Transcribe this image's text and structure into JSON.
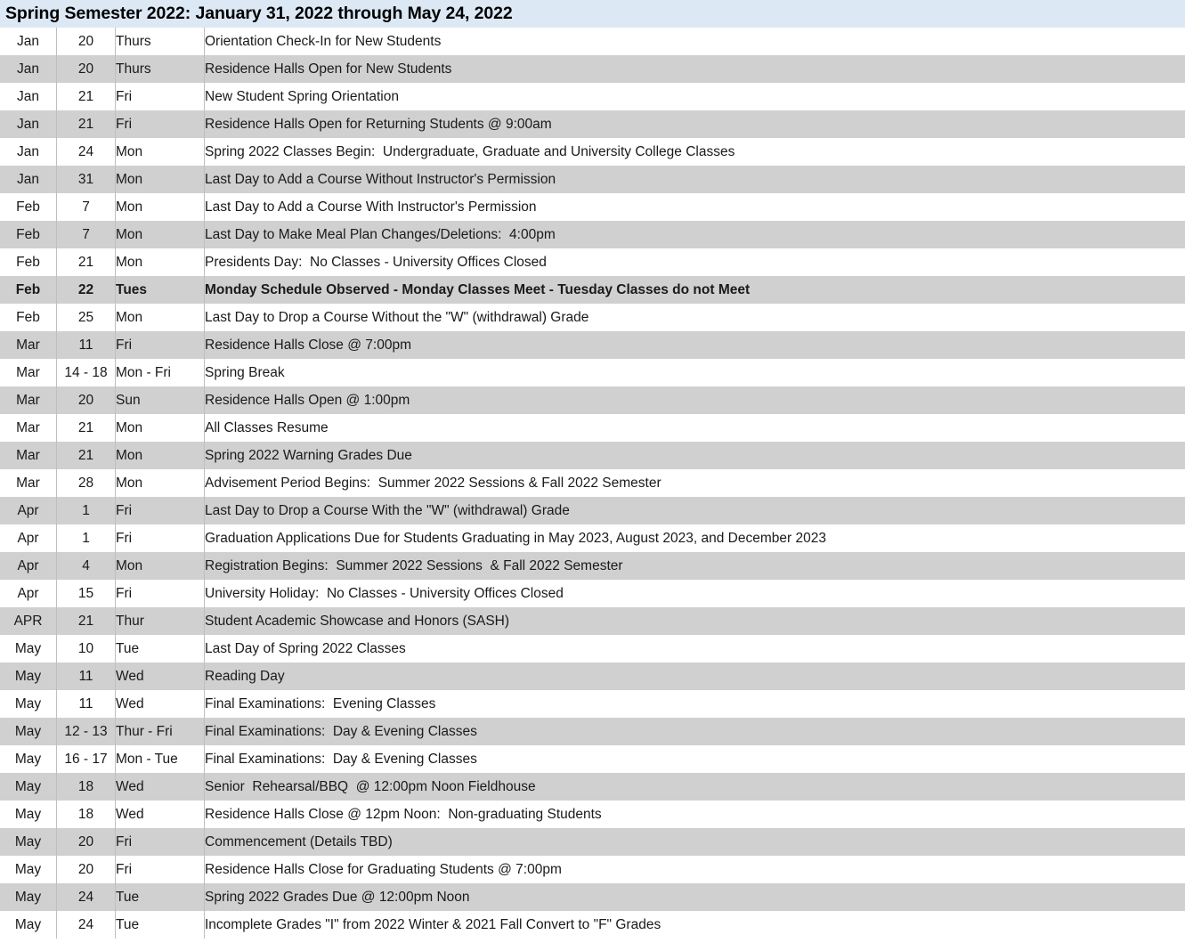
{
  "header": {
    "title": "Spring Semester 2022: January 31, 2022 through May 24, 2022",
    "background_color": "#dce9f5"
  },
  "colors": {
    "header_blue": "#dce9f5",
    "row_shaded": "#d0d0d0",
    "row_plain": "#ffffff",
    "divider": "#bfbfbf",
    "text": "#1a1a1a"
  },
  "table": {
    "columns": [
      "month",
      "day",
      "weekday",
      "event"
    ],
    "rows": [
      {
        "month": "Jan",
        "day": "20",
        "weekday": "Thurs",
        "event": "Orientation Check-In for New Students",
        "shaded": false,
        "bold": false
      },
      {
        "month": "Jan",
        "day": "20",
        "weekday": "Thurs",
        "event": "Residence Halls Open for New Students",
        "shaded": true,
        "bold": false
      },
      {
        "month": "Jan",
        "day": "21",
        "weekday": "Fri",
        "event": "New Student Spring Orientation",
        "shaded": false,
        "bold": false
      },
      {
        "month": "Jan",
        "day": "21",
        "weekday": "Fri",
        "event": "Residence Halls Open for Returning Students @ 9:00am",
        "shaded": true,
        "bold": false
      },
      {
        "month": "Jan",
        "day": "24",
        "weekday": "Mon",
        "event": "Spring 2022 Classes Begin:  Undergraduate, Graduate and University College Classes",
        "shaded": false,
        "bold": false
      },
      {
        "month": "Jan",
        "day": "31",
        "weekday": "Mon",
        "event": "Last Day to Add a Course Without Instructor's Permission",
        "shaded": true,
        "bold": false
      },
      {
        "month": "Feb",
        "day": "7",
        "weekday": "Mon",
        "event": "Last Day to Add a Course With Instructor's Permission",
        "shaded": false,
        "bold": false
      },
      {
        "month": "Feb",
        "day": "7",
        "weekday": "Mon",
        "event": "Last Day to Make Meal Plan Changes/Deletions:  4:00pm",
        "shaded": true,
        "bold": false
      },
      {
        "month": "Feb",
        "day": "21",
        "weekday": "Mon",
        "event": "Presidents Day:  No Classes - University Offices Closed",
        "shaded": false,
        "bold": false
      },
      {
        "month": "Feb",
        "day": "22",
        "weekday": "Tues",
        "event": "Monday Schedule Observed - Monday Classes Meet - Tuesday Classes do not Meet",
        "shaded": true,
        "bold": true
      },
      {
        "month": "Feb",
        "day": "25",
        "weekday": "Mon",
        "event": "Last Day to Drop a Course Without the \"W\" (withdrawal) Grade",
        "shaded": false,
        "bold": false
      },
      {
        "month": "Mar",
        "day": "11",
        "weekday": "Fri",
        "event": "Residence Halls Close @ 7:00pm",
        "shaded": true,
        "bold": false
      },
      {
        "month": "Mar",
        "day": "14 - 18",
        "weekday": "Mon - Fri",
        "event": "Spring Break",
        "shaded": false,
        "bold": false
      },
      {
        "month": "Mar",
        "day": "20",
        "weekday": "Sun",
        "event": "Residence Halls Open @ 1:00pm",
        "shaded": true,
        "bold": false
      },
      {
        "month": "Mar",
        "day": "21",
        "weekday": "Mon",
        "event": "All Classes Resume",
        "shaded": false,
        "bold": false
      },
      {
        "month": "Mar",
        "day": "21",
        "weekday": "Mon",
        "event": "Spring 2022 Warning Grades Due",
        "shaded": true,
        "bold": false
      },
      {
        "month": "Mar",
        "day": "28",
        "weekday": "Mon",
        "event": "Advisement Period Begins:  Summer 2022 Sessions & Fall 2022 Semester",
        "shaded": false,
        "bold": false
      },
      {
        "month": "Apr",
        "day": "1",
        "weekday": "Fri",
        "event": "Last Day to Drop a Course With the \"W\" (withdrawal) Grade",
        "shaded": true,
        "bold": false
      },
      {
        "month": "Apr",
        "day": "1",
        "weekday": "Fri",
        "event": "Graduation Applications Due for Students Graduating in May 2023, August 2023, and December 2023",
        "shaded": false,
        "bold": false
      },
      {
        "month": "Apr",
        "day": "4",
        "weekday": "Mon",
        "event": "Registration Begins:  Summer 2022 Sessions  & Fall 2022 Semester",
        "shaded": true,
        "bold": false
      },
      {
        "month": "Apr",
        "day": "15",
        "weekday": "Fri",
        "event": "University Holiday:  No Classes - University Offices Closed",
        "shaded": false,
        "bold": false
      },
      {
        "month": "APR",
        "day": "21",
        "weekday": "Thur",
        "event": "Student Academic Showcase and Honors (SASH)",
        "shaded": true,
        "bold": false
      },
      {
        "month": "May",
        "day": "10",
        "weekday": "Tue",
        "event": "Last Day of Spring 2022 Classes",
        "shaded": false,
        "bold": false
      },
      {
        "month": "May",
        "day": "11",
        "weekday": "Wed",
        "event": "Reading Day",
        "shaded": true,
        "bold": false
      },
      {
        "month": "May",
        "day": "11",
        "weekday": "Wed",
        "event": "Final Examinations:  Evening Classes",
        "shaded": false,
        "bold": false
      },
      {
        "month": "May",
        "day": "12 - 13",
        "weekday": "Thur - Fri",
        "event": "Final Examinations:  Day & Evening Classes",
        "shaded": true,
        "bold": false
      },
      {
        "month": "May",
        "day": "16 - 17",
        "weekday": "Mon - Tue",
        "event": "Final Examinations:  Day & Evening Classes",
        "shaded": false,
        "bold": false
      },
      {
        "month": "May",
        "day": "18",
        "weekday": "Wed",
        "event": "Senior  Rehearsal/BBQ  @ 12:00pm Noon Fieldhouse",
        "shaded": true,
        "bold": false
      },
      {
        "month": "May",
        "day": "18",
        "weekday": "Wed",
        "event": "Residence Halls Close @ 12pm Noon:  Non-graduating Students",
        "shaded": false,
        "bold": false
      },
      {
        "month": "May",
        "day": "20",
        "weekday": "Fri",
        "event": "Commencement (Details TBD)",
        "shaded": true,
        "bold": false
      },
      {
        "month": "May",
        "day": "20",
        "weekday": "Fri",
        "event": "Residence Halls Close for Graduating Students @ 7:00pm",
        "shaded": false,
        "bold": false
      },
      {
        "month": "May",
        "day": "24",
        "weekday": "Tue",
        "event": "Spring 2022 Grades Due @ 12:00pm Noon",
        "shaded": true,
        "bold": false
      },
      {
        "month": "May",
        "day": "24",
        "weekday": "Tue",
        "event": "Incomplete Grades \"I\" from 2022 Winter & 2021 Fall Convert to \"F\" Grades",
        "shaded": false,
        "bold": false
      }
    ]
  }
}
